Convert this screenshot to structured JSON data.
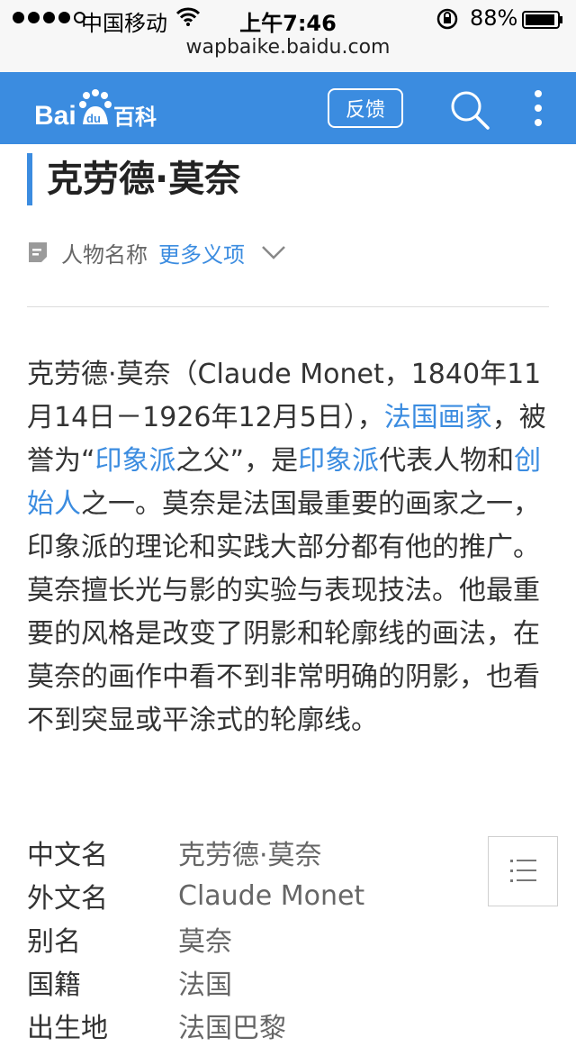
{
  "status_bar": {
    "carrier": "中国移动",
    "time": "上午7:46",
    "battery": "88%"
  },
  "browser": {
    "url": "wapbaike.baidu.com"
  },
  "app_bar": {
    "logo_text": "Bai du 百科",
    "feedback_label": "反馈",
    "brand_color": "#3b8ce0"
  },
  "article": {
    "title": "克劳德·莫奈",
    "category": "人物名称",
    "more_meanings": "更多义项",
    "summary": {
      "p1": "克劳德·莫奈（Claude Monet，1840年11月14日－1926年12月5日），",
      "link1": "法国画家",
      "p2": "，被誉为“",
      "link2": "印象派",
      "p3": "之父”，是",
      "link3": "印象派",
      "p4": "代表人物和",
      "link4": "创始人",
      "p5": "之一。莫奈是法国最重要的画家之一，印象派的理论和实践大部分都有他的推广。莫奈擅长光与影的实验与表现技法。他最重要的风格是改变了阴影和轮廓线的画法，在莫奈的画作中看不到非常明确的阴影，也看不到突显或平涂式的轮廓线。"
    },
    "infobox": [
      {
        "key": "中文名",
        "value": "克劳德·莫奈"
      },
      {
        "key": "外文名",
        "value": "Claude Monet"
      },
      {
        "key": "别名",
        "value": "莫奈"
      },
      {
        "key": "国籍",
        "value": "法国"
      },
      {
        "key": "出生地",
        "value": "法国巴黎"
      }
    ]
  }
}
